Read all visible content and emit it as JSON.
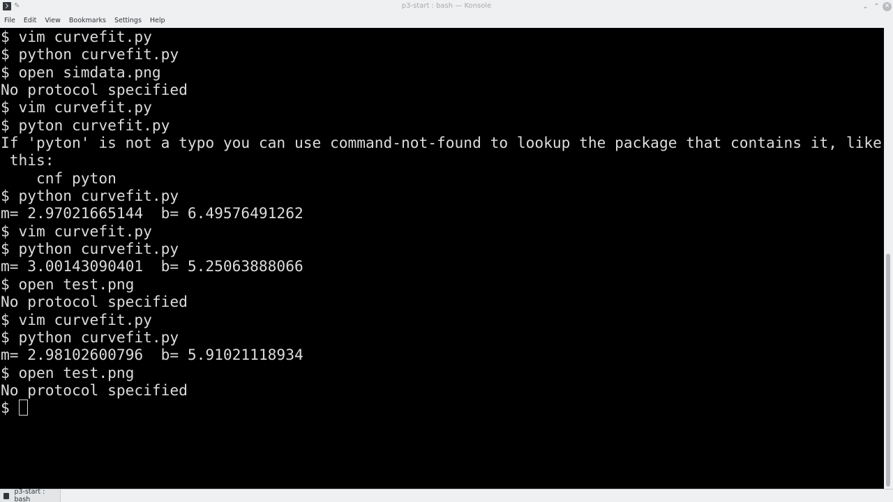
{
  "window": {
    "title": "p3-start : bash — Konsole"
  },
  "menubar": {
    "items": [
      "File",
      "Edit",
      "View",
      "Bookmarks",
      "Settings",
      "Help"
    ]
  },
  "terminal": {
    "lines": [
      "$ vim curvefit.py",
      "$ python curvefit.py",
      "$ open simdata.png",
      "No protocol specified",
      "$ vim curvefit.py",
      "$ pyton curvefit.py",
      "If 'pyton' is not a typo you can use command-not-found to lookup the package that contains it, like",
      " this:",
      "    cnf pyton",
      "$ python curvefit.py",
      "m= 2.97021665144  b= 6.49576491262",
      "$ vim curvefit.py",
      "$ python curvefit.py",
      "m= 3.00143090401  b= 5.25063888066",
      "$ open test.png",
      "No protocol specified",
      "$ vim curvefit.py",
      "$ python curvefit.py",
      "m= 2.98102600796  b= 5.91021118934",
      "$ open test.png",
      "No protocol specified"
    ],
    "prompt": "$ "
  },
  "tabs": [
    {
      "label": "p3-start : bash"
    }
  ],
  "colors": {
    "terminal_bg": "#000000",
    "terminal_fg": "#dcdcdc",
    "chrome_bg": "#eff0f1"
  }
}
